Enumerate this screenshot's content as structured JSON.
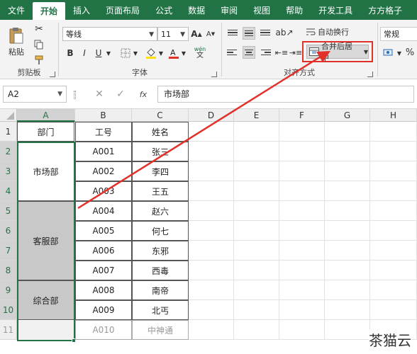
{
  "tabs": [
    "文件",
    "开始",
    "插入",
    "页面布局",
    "公式",
    "数据",
    "审阅",
    "视图",
    "帮助",
    "开发工具",
    "方方格子"
  ],
  "active_tab": "开始",
  "ribbon": {
    "clipboard": {
      "paste_label": "粘贴",
      "group_label": "剪贴板"
    },
    "font": {
      "font_name": "等线",
      "font_size": "11",
      "group_label": "字体",
      "bold": "B",
      "italic": "I",
      "underline": "U",
      "grow": "A",
      "shrink": "A",
      "wen": "wén"
    },
    "alignment": {
      "wrap_label": "自动换行",
      "merge_label": "合并后居中",
      "group_label": "对齐方式"
    },
    "number": {
      "format_value": "常规",
      "percent": "%"
    }
  },
  "formula_bar": {
    "name_box": "A2",
    "fx": "fx",
    "content": "市场部"
  },
  "columns": [
    "A",
    "B",
    "C",
    "D",
    "E",
    "F",
    "G",
    "H"
  ],
  "rows": [
    "1",
    "2",
    "3",
    "4",
    "5",
    "6",
    "7",
    "8",
    "9",
    "10",
    "11"
  ],
  "table": {
    "headers": [
      "部门",
      "工号",
      "姓名"
    ],
    "departments": [
      "市场部",
      "客服部",
      "综合部"
    ],
    "ids": [
      "A001",
      "A002",
      "A003",
      "A004",
      "A005",
      "A006",
      "A007",
      "A008",
      "A009",
      "A010"
    ],
    "names": [
      "张三",
      "李四",
      "王五",
      "赵六",
      "何七",
      "东邪",
      "西毒",
      "南帝",
      "北丐",
      "中神通"
    ]
  },
  "annotation_color": "#e0312b",
  "accent_color": "#217346",
  "watermark": "茶猫云"
}
